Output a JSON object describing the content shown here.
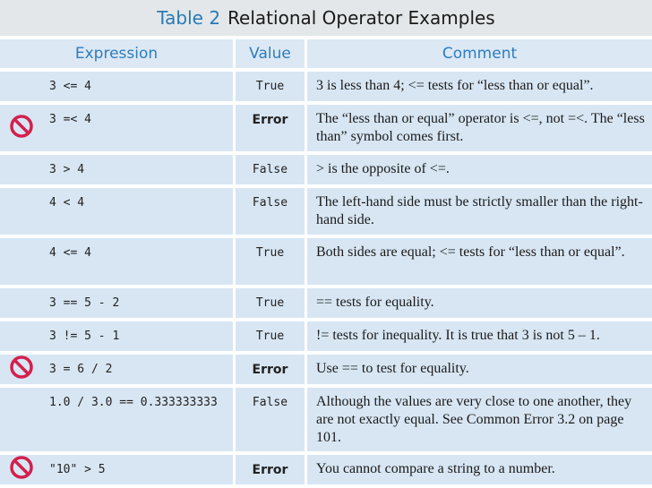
{
  "table_title": {
    "number": "Table 2",
    "text": "Relational Operator Examples"
  },
  "headers": {
    "expression": "Expression",
    "value": "Value",
    "comment": "Comment"
  },
  "colors": {
    "header_text": "#2d7dbf",
    "row_bg": "#d8e6f3",
    "header_bg": "#dce8f4",
    "error_icon": "#d3204e"
  },
  "rows": [
    {
      "icon": "",
      "expression": "3 <= 4",
      "value": "True",
      "comment": "3 is less than 4; <= tests for “less than or equal”."
    },
    {
      "icon": "no-entry-icon",
      "expression": "3 =< 4",
      "value": "Error",
      "comment": "The “less than or equal” operator is <=, not =<. The “less than” symbol comes first."
    },
    {
      "icon": "",
      "expression": "3 > 4",
      "value": "False",
      "comment": "> is the opposite of <=."
    },
    {
      "icon": "",
      "expression": "4 < 4",
      "value": "False",
      "comment": "The left-hand side must be strictly smaller than the right-hand side."
    },
    {
      "icon": "",
      "expression": "4 <= 4",
      "value": "True",
      "comment": "Both sides are equal; <= tests for “less than or equal”."
    },
    {
      "icon": "",
      "expression": "3 == 5 - 2",
      "value": "True",
      "comment": "== tests for equality."
    },
    {
      "icon": "",
      "expression": "3 != 5 - 1",
      "value": "True",
      "comment": "!= tests for inequality. It is true that 3 is not 5 – 1."
    },
    {
      "icon": "no-entry-icon",
      "expression": "3 = 6 / 2",
      "value": "Error",
      "comment": "Use == to test for equality."
    },
    {
      "icon": "",
      "expression": "1.0 / 3.0 == 0.333333333",
      "value": "False",
      "comment": "Although the values are very close to one another, they are not exactly equal. See Common Error 3.2 on page 101."
    },
    {
      "icon": "no-entry-icon",
      "expression": "\"10\" > 5",
      "value": "Error",
      "comment": "You cannot compare a string to a number."
    }
  ]
}
